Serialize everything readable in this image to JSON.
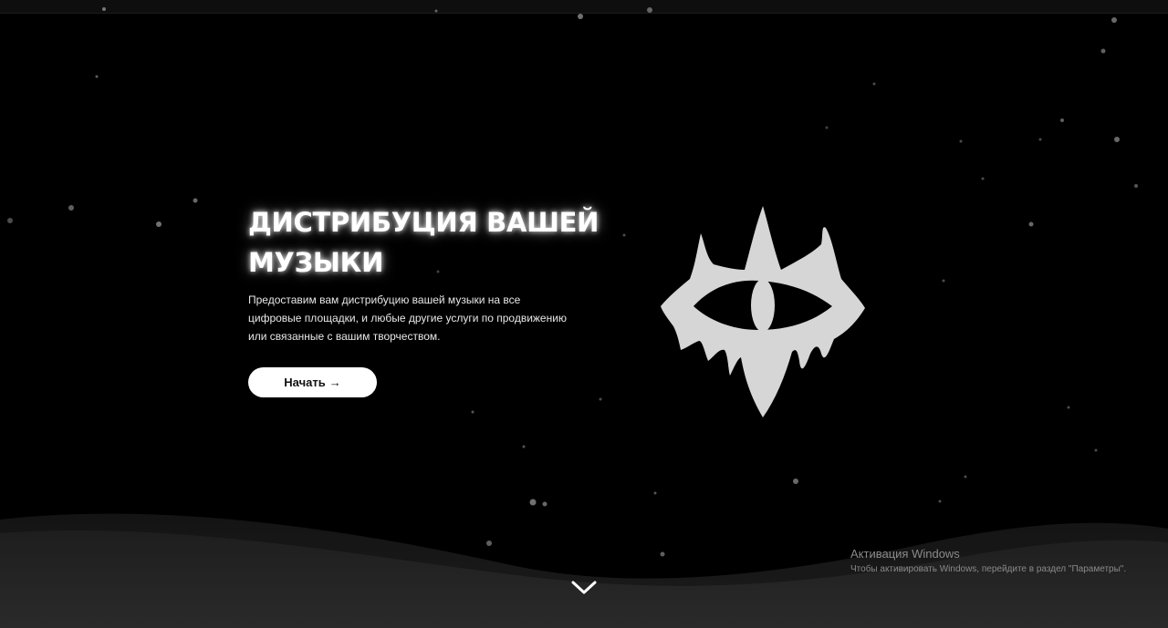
{
  "hero": {
    "title": "ДИСТРИБУЦИЯ ВАШЕЙ МУЗЫКИ",
    "description": "Предоставим вам дистрибуцию вашей музыки на все цифровые площадки, и любые другие услуги по продвижению или связанные с вашим творчеством.",
    "cta_label": "Начать",
    "cta_arrow": "→"
  },
  "icons": {
    "logo": "eye-star-logo",
    "scroll": "chevron-down-icon"
  },
  "windows_activation": {
    "title": "Активация Windows",
    "text": "Чтобы активировать Windows, перейдите в раздел \"Параметры\"."
  },
  "colors": {
    "background": "#000000",
    "accent": "#ffffff",
    "logo_fill": "#d6d6d6"
  }
}
